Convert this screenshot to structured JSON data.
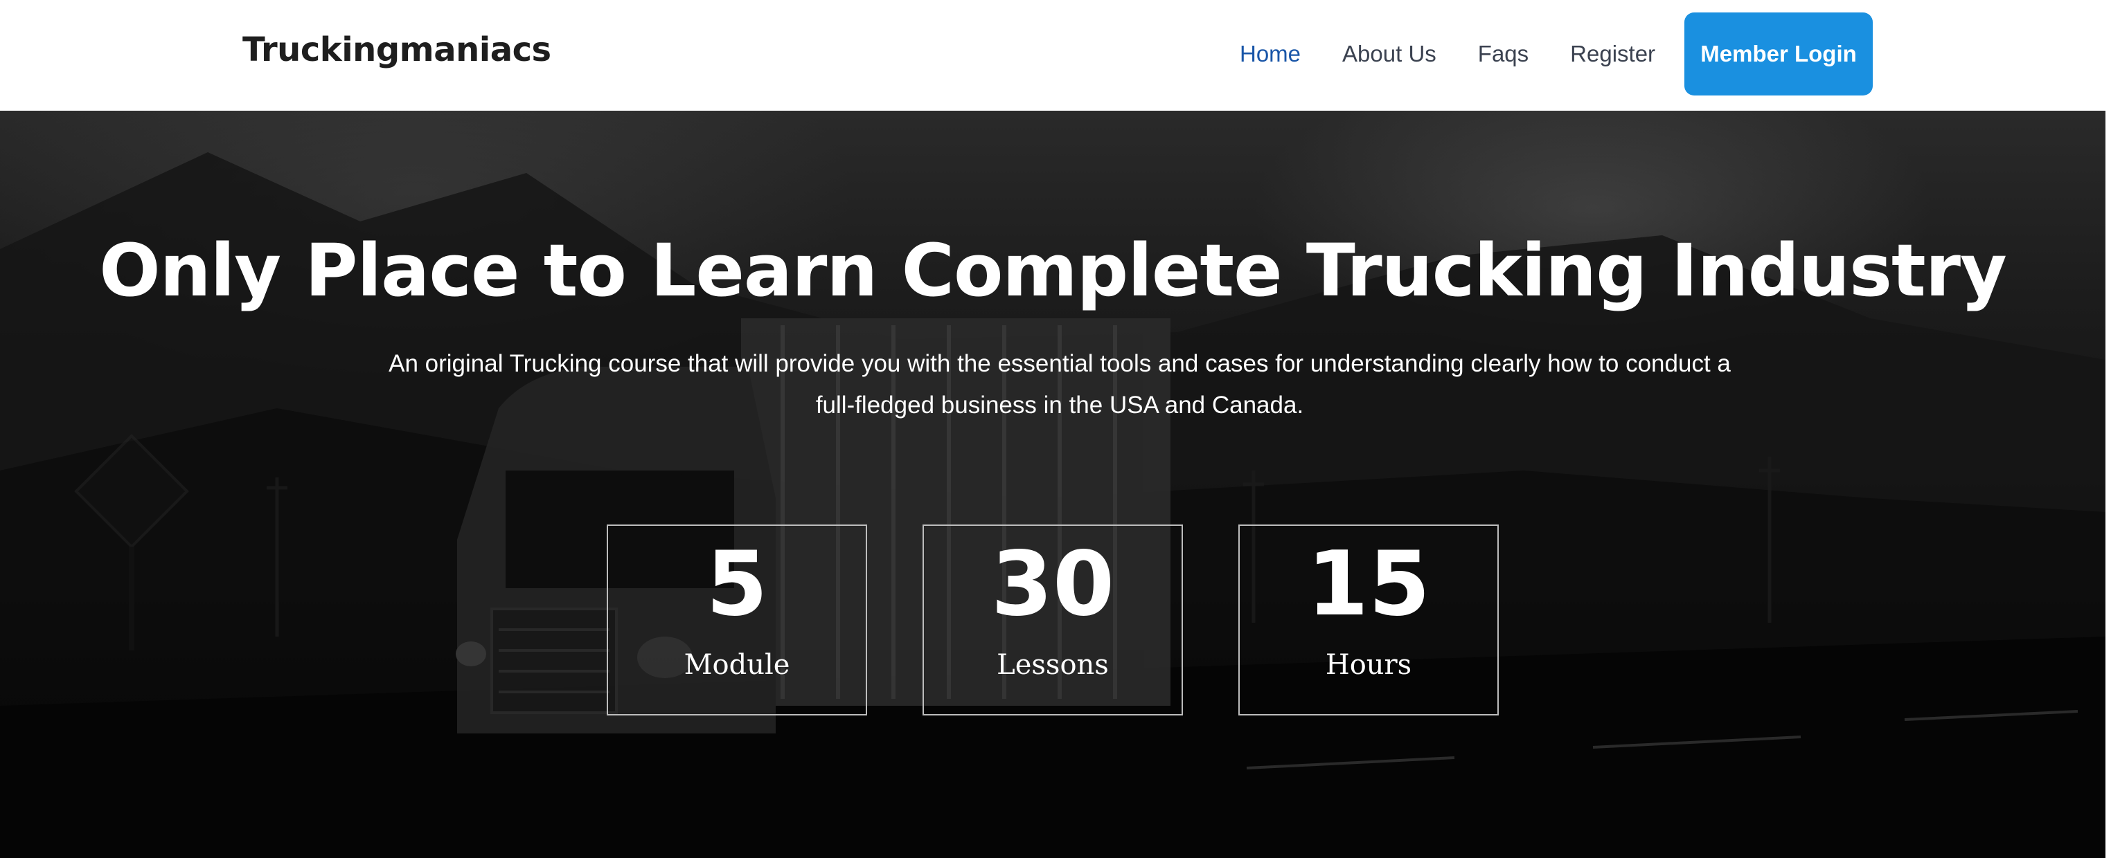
{
  "header": {
    "brand": "Truckingmaniacs",
    "nav": [
      {
        "label": "Home",
        "active": true
      },
      {
        "label": "About Us"
      },
      {
        "label": "Faqs"
      },
      {
        "label": "Register"
      }
    ],
    "login_button": "Member Login"
  },
  "hero": {
    "title": "Only Place to Learn Complete Trucking Industry",
    "description": "An original Trucking course that will provide you with the essential tools and cases for understanding clearly how to conduct a full-fledged business in the USA and Canada.",
    "stats": [
      {
        "value": "5",
        "label": "Module"
      },
      {
        "value": "30",
        "label": "Lessons"
      },
      {
        "value": "15",
        "label": "Hours"
      }
    ]
  },
  "colors": {
    "accent": "#1a90e0",
    "nav_active": "#1a56a8",
    "nav_text": "#3b4250",
    "brand_text": "#1e1e1e"
  }
}
